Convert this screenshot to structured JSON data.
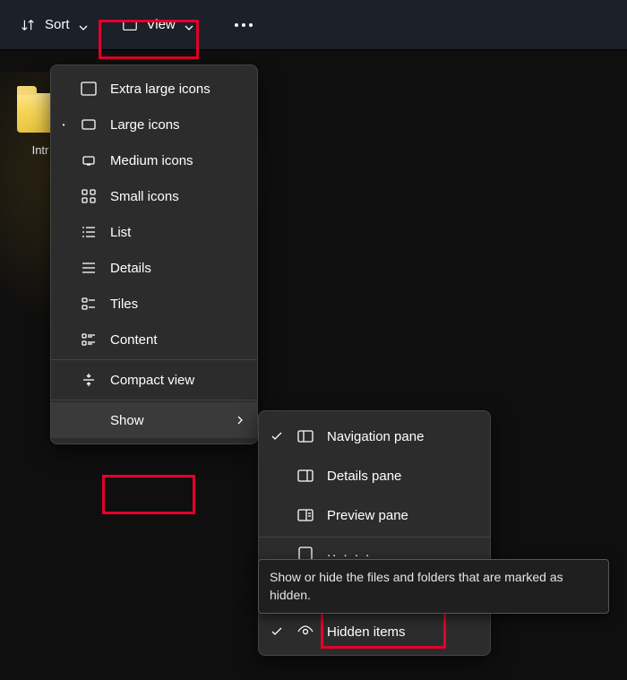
{
  "toolbar": {
    "sort_label": "Sort",
    "view_label": "View"
  },
  "folder": {
    "name": "Intr"
  },
  "view_menu": {
    "items": [
      {
        "label": "Extra large icons",
        "icon": "rect-xl",
        "selected": false
      },
      {
        "label": "Large icons",
        "icon": "rect-l",
        "selected": true
      },
      {
        "label": "Medium icons",
        "icon": "rect-m",
        "selected": false
      },
      {
        "label": "Small icons",
        "icon": "grid-sm",
        "selected": false
      },
      {
        "label": "List",
        "icon": "list",
        "selected": false
      },
      {
        "label": "Details",
        "icon": "details",
        "selected": false
      },
      {
        "label": "Tiles",
        "icon": "tiles",
        "selected": false
      },
      {
        "label": "Content",
        "icon": "content",
        "selected": false
      }
    ],
    "compact_label": "Compact view",
    "show_label": "Show"
  },
  "show_submenu": {
    "items": [
      {
        "label": "Navigation pane",
        "icon": "pane-left",
        "checked": true
      },
      {
        "label": "Details pane",
        "icon": "pane-right",
        "checked": false
      },
      {
        "label": "Preview pane",
        "icon": "pane-prev",
        "checked": false
      }
    ],
    "hidden_label": "Hidden items",
    "hidden_checked": true
  },
  "tooltip": {
    "text": "Show or hide the files and folders that are marked as hidden."
  }
}
